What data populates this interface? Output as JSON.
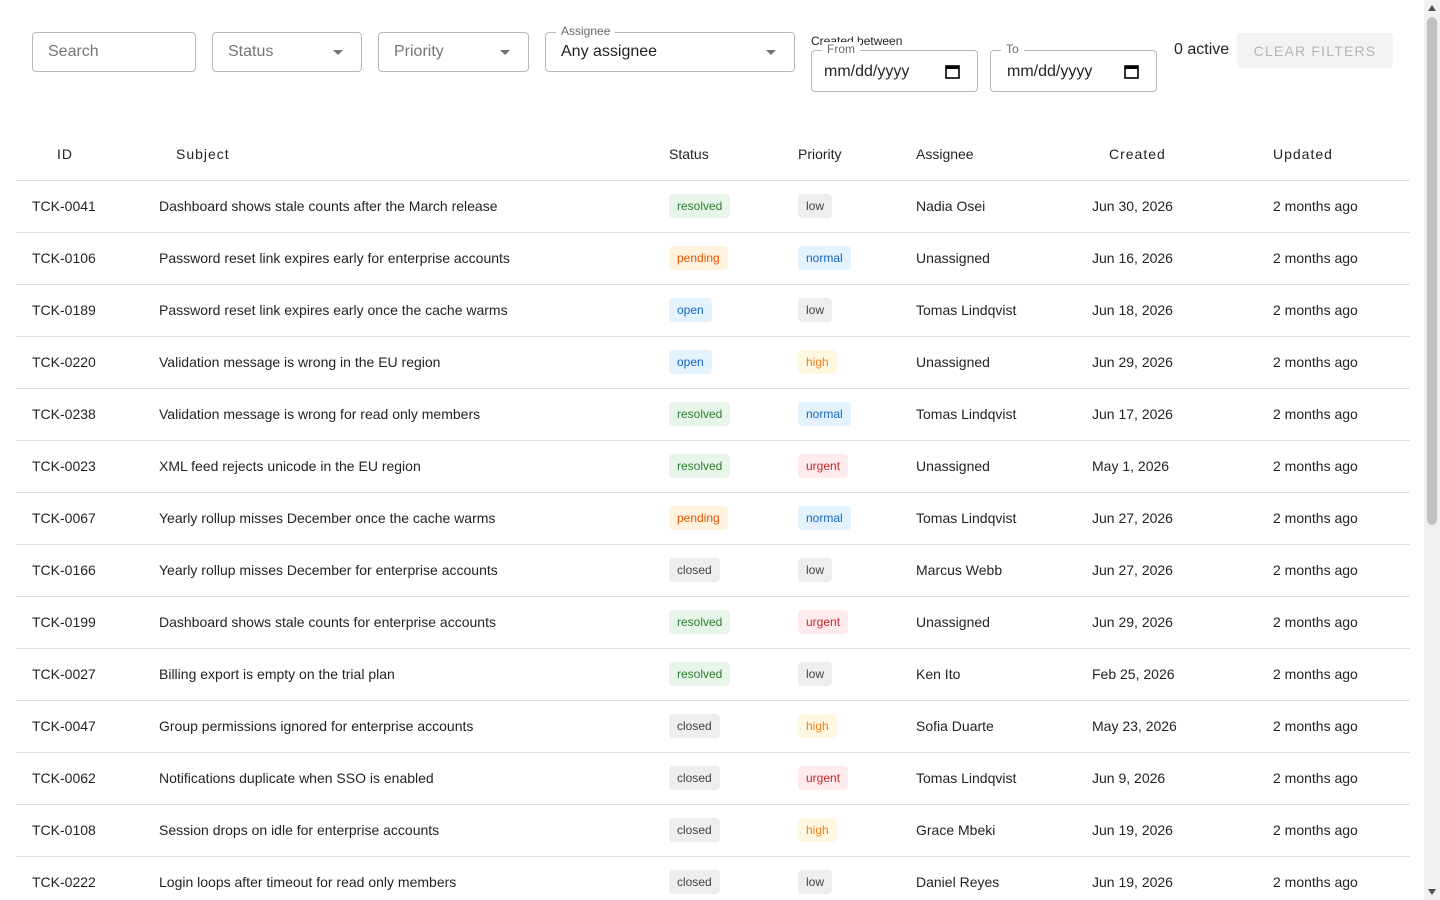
{
  "filters": {
    "search_placeholder": "Search",
    "status_placeholder": "Status",
    "priority_placeholder": "Priority",
    "assignee_label": "Assignee",
    "assignee_value": "Any assignee",
    "created_between_label": "Created between",
    "from_label": "From",
    "from_value": "mm/dd/yyyy",
    "to_label": "To",
    "to_value": "mm/dd/yyyy",
    "active_count": "0 active",
    "clear_label": "CLEAR FILTERS"
  },
  "table": {
    "headers": {
      "id": "ID",
      "subject": "Subject",
      "status": "Status",
      "priority": "Priority",
      "assignee": "Assignee",
      "created": "Created",
      "updated": "Updated"
    },
    "rows": [
      {
        "id": "TCK-0041",
        "subject": "Dashboard shows stale counts after the March release",
        "status": "resolved",
        "priority": "low",
        "assignee": "Nadia Osei",
        "created": "Jun 30, 2026",
        "updated": "2 months ago"
      },
      {
        "id": "TCK-0106",
        "subject": "Password reset link expires early for enterprise accounts",
        "status": "pending",
        "priority": "normal",
        "assignee": "Unassigned",
        "created": "Jun 16, 2026",
        "updated": "2 months ago"
      },
      {
        "id": "TCK-0189",
        "subject": "Password reset link expires early once the cache warms",
        "status": "open",
        "priority": "low",
        "assignee": "Tomas Lindqvist",
        "created": "Jun 18, 2026",
        "updated": "2 months ago"
      },
      {
        "id": "TCK-0220",
        "subject": "Validation message is wrong in the EU region",
        "status": "open",
        "priority": "high",
        "assignee": "Unassigned",
        "created": "Jun 29, 2026",
        "updated": "2 months ago"
      },
      {
        "id": "TCK-0238",
        "subject": "Validation message is wrong for read only members",
        "status": "resolved",
        "priority": "normal",
        "assignee": "Tomas Lindqvist",
        "created": "Jun 17, 2026",
        "updated": "2 months ago"
      },
      {
        "id": "TCK-0023",
        "subject": "XML feed rejects unicode in the EU region",
        "status": "resolved",
        "priority": "urgent",
        "assignee": "Unassigned",
        "created": "May 1, 2026",
        "updated": "2 months ago"
      },
      {
        "id": "TCK-0067",
        "subject": "Yearly rollup misses December once the cache warms",
        "status": "pending",
        "priority": "normal",
        "assignee": "Tomas Lindqvist",
        "created": "Jun 27, 2026",
        "updated": "2 months ago"
      },
      {
        "id": "TCK-0166",
        "subject": "Yearly rollup misses December for enterprise accounts",
        "status": "closed",
        "priority": "low",
        "assignee": "Marcus Webb",
        "created": "Jun 27, 2026",
        "updated": "2 months ago"
      },
      {
        "id": "TCK-0199",
        "subject": "Dashboard shows stale counts for enterprise accounts",
        "status": "resolved",
        "priority": "urgent",
        "assignee": "Unassigned",
        "created": "Jun 29, 2026",
        "updated": "2 months ago"
      },
      {
        "id": "TCK-0027",
        "subject": "Billing export is empty on the trial plan",
        "status": "resolved",
        "priority": "low",
        "assignee": "Ken Ito",
        "created": "Feb 25, 2026",
        "updated": "2 months ago"
      },
      {
        "id": "TCK-0047",
        "subject": "Group permissions ignored for enterprise accounts",
        "status": "closed",
        "priority": "high",
        "assignee": "Sofia Duarte",
        "created": "May 23, 2026",
        "updated": "2 months ago"
      },
      {
        "id": "TCK-0062",
        "subject": "Notifications duplicate when SSO is enabled",
        "status": "closed",
        "priority": "urgent",
        "assignee": "Tomas Lindqvist",
        "created": "Jun 9, 2026",
        "updated": "2 months ago"
      },
      {
        "id": "TCK-0108",
        "subject": "Session drops on idle for enterprise accounts",
        "status": "closed",
        "priority": "high",
        "assignee": "Grace Mbeki",
        "created": "Jun 19, 2026",
        "updated": "2 months ago"
      },
      {
        "id": "TCK-0222",
        "subject": "Login loops after timeout for read only members",
        "status": "closed",
        "priority": "low",
        "assignee": "Daniel Reyes",
        "created": "Jun 19, 2026",
        "updated": "2 months ago"
      }
    ]
  },
  "colors": {
    "resolved": "#2e7d32",
    "pending": "#e65100",
    "open": "#1565c0",
    "closed": "#424242",
    "low": "#424242",
    "normal": "#1565c0",
    "high": "#f57f17",
    "urgent": "#c62828"
  },
  "scroll_position": 0.0
}
